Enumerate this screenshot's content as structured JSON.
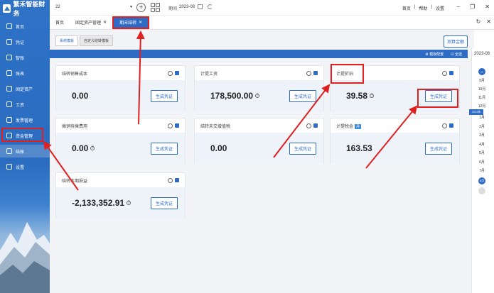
{
  "app": {
    "logo_text": "繁禾智能财务"
  },
  "sidebar": {
    "items": [
      {
        "label": "首页",
        "icon": "home-icon"
      },
      {
        "label": "凭证",
        "icon": "voucher-icon"
      },
      {
        "label": "智账",
        "icon": "smart-ledger-icon"
      },
      {
        "label": "账表",
        "icon": "report-icon"
      },
      {
        "label": "固定资产",
        "icon": "asset-icon"
      },
      {
        "label": "工资",
        "icon": "salary-icon"
      },
      {
        "label": "发票管理",
        "icon": "invoice-icon"
      },
      {
        "label": "资金管理",
        "icon": "fund-icon"
      },
      {
        "label": "结账",
        "icon": "closing-icon",
        "active": true
      },
      {
        "label": "设置",
        "icon": "settings-icon"
      }
    ]
  },
  "topbar": {
    "account": "22",
    "period_label": "期间",
    "period_value": "2023-08",
    "links": [
      "首页",
      "帮助",
      "设置"
    ]
  },
  "tabs": [
    {
      "label": "首页",
      "closable": false
    },
    {
      "label": "固定资产管理",
      "closable": true
    },
    {
      "label": "期末结转",
      "closable": true,
      "active": true
    }
  ],
  "subtabs": [
    {
      "label": "系统模板",
      "active": true
    },
    {
      "label": "自定义结转模板",
      "active": false
    }
  ],
  "toolbar": {
    "calc_button": "测算金额",
    "template_config": "模板配置",
    "select_all": "全选"
  },
  "cards": [
    {
      "title": "结转销售成本",
      "amount": "0.00",
      "has_help": false,
      "button": "生成凭证"
    },
    {
      "title": "计提工资",
      "amount": "178,500.00",
      "has_help": true,
      "button": "生成凭证"
    },
    {
      "title": "计提折旧",
      "amount": "39.58",
      "has_help": true,
      "button": "生成凭证"
    },
    {
      "title": "摊销待摊费用",
      "amount": "0.00",
      "has_help": true,
      "button": "生成凭证"
    },
    {
      "title": "结转未交增值税",
      "amount": "0.00",
      "has_help": false,
      "button": "生成凭证"
    },
    {
      "title": "计提税金",
      "badge": "月",
      "amount": "163.53",
      "has_help": false,
      "button": "生成凭证"
    },
    {
      "title": "结转本期损益",
      "amount": "-2,133,352.91",
      "has_help": true,
      "button": "生成凭证"
    }
  ],
  "period_panel": {
    "year": "2023-08",
    "months_top": [
      "9月",
      "10月",
      "11月",
      "12月"
    ],
    "year_tag": "2023年",
    "months_bottom": [
      "1月",
      "2月",
      "3月",
      "4月",
      "5月",
      "6月",
      "7月"
    ],
    "current": "8月"
  },
  "colors": {
    "primary": "#2e6bc4",
    "highlight": "#e02020"
  }
}
